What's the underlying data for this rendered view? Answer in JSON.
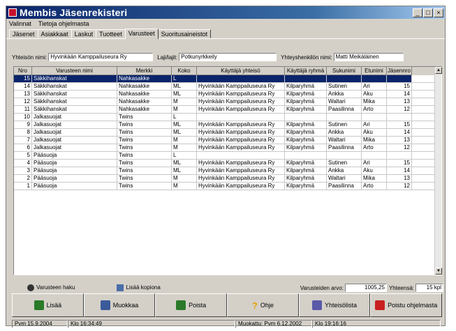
{
  "app": {
    "title": "Membis Jäsenrekisteri"
  },
  "menu": [
    "Valinnat",
    "Tietoja ohjelmasta"
  ],
  "tabs": [
    "Jäsenet",
    "Asiakkaat",
    "Laskut",
    "Tuotteet",
    "Varusteet",
    "Suoritusaineistot"
  ],
  "info": {
    "club_label": "Yhteisön nimi:",
    "club_value": "Hyvinkään Kamppailuseura Ry",
    "sport_label": "Laji/lajit:",
    "sport_value": "Potkunyrkkeily",
    "contact_label": "Yhteyshenkilön nimi:",
    "contact_value": "Matti Meikäläinen"
  },
  "table": {
    "columns": [
      "Nro",
      "Varusteen nimi",
      "Merkki",
      "Koko",
      "Käyttäjä yhteisö",
      "Käyttäjä ryhmä",
      "Sukunimi",
      "Etunimi",
      "Jäsennro"
    ],
    "rows": [
      [
        "15",
        "Säkkihanskat",
        "Nahkasakke",
        "L",
        "",
        "",
        "",
        "",
        ""
      ],
      [
        "14",
        "Säkkihanskat",
        "Nahkasakke",
        "ML",
        "Hyvinkään Kamppailuseura Ry",
        "Kilparyhmä",
        "Sutinen",
        "Ari",
        "15"
      ],
      [
        "13",
        "Säkkihanskat",
        "Nahkasakke",
        "ML",
        "Hyvinkään Kamppailuseura Ry",
        "Kilparyhmä",
        "Ankka",
        "Aku",
        "14"
      ],
      [
        "12",
        "Säkkihanskat",
        "Nahkasakke",
        "M",
        "Hyvinkään Kamppailuseura Ry",
        "Kilparyhmä",
        "Waltari",
        "Mika",
        "13"
      ],
      [
        "11",
        "Säkkihanskat",
        "Nahkasakke",
        "M",
        "Hyvinkään Kamppailuseura Ry",
        "Kilparyhmä",
        "Paasilinna",
        "Arto",
        "12"
      ],
      [
        "10",
        "Jalkasuojat",
        "Twins",
        "L",
        "",
        "",
        "",
        "",
        ""
      ],
      [
        "9",
        "Jalkasuojat",
        "Twins",
        "ML",
        "Hyvinkään Kamppailuseura Ry",
        "Kilparyhmä",
        "Sutinen",
        "Ari",
        "15"
      ],
      [
        "8",
        "Jalkasuojat",
        "Twins",
        "ML",
        "Hyvinkään Kamppailuseura Ry",
        "Kilparyhmä",
        "Ankka",
        "Aku",
        "14"
      ],
      [
        "7",
        "Jalkasuojat",
        "Twins",
        "M",
        "Hyvinkään Kamppailuseura Ry",
        "Kilparyhmä",
        "Waltari",
        "Mika",
        "13"
      ],
      [
        "6",
        "Jalkasuojat",
        "Twins",
        "M",
        "Hyvinkään Kamppailuseura Ry",
        "Kilparyhmä",
        "Paasilinna",
        "Arto",
        "12"
      ],
      [
        "5",
        "Pääsuoja",
        "Twins",
        "L",
        "",
        "",
        "",
        "",
        ""
      ],
      [
        "4",
        "Pääsuoja",
        "Twins",
        "ML",
        "Hyvinkään Kamppailuseura Ry",
        "Kilparyhmä",
        "Sutinen",
        "Ari",
        "15"
      ],
      [
        "3",
        "Pääsuoja",
        "Twins",
        "ML",
        "Hyvinkään Kamppailuseura Ry",
        "Kilparyhmä",
        "Ankka",
        "Aku",
        "14"
      ],
      [
        "2",
        "Pääsuoja",
        "Twins",
        "M",
        "Hyvinkään Kamppailuseura Ry",
        "Kilparyhmä",
        "Waltari",
        "Mika",
        "13"
      ],
      [
        "1",
        "Pääsuoja",
        "Twins",
        "M",
        "Hyvinkään Kamppailuseura Ry",
        "Kilparyhmä",
        "Paasilinna",
        "Arto",
        "12"
      ]
    ]
  },
  "tools": {
    "search_label": "Varusteen haku",
    "copy_label": "Lisää kopiona",
    "value_label": "Varusteiden arvo:",
    "value": "1005,25",
    "total_label": "Yhteensä:",
    "total": "15 kpl"
  },
  "buttons": {
    "add": "Lisää",
    "edit": "Muokkaa",
    "delete": "Poista",
    "help": "Ohje",
    "contacts": "Yhteisölista",
    "exit": "Poistu ohjelmasta"
  },
  "status": {
    "date": "Pvm 15.9.2004",
    "time": "Klo 16:34:49",
    "modified": "Muokattu: Pvm 6.12.2002",
    "modified_time": "Klo 19:16:16"
  }
}
